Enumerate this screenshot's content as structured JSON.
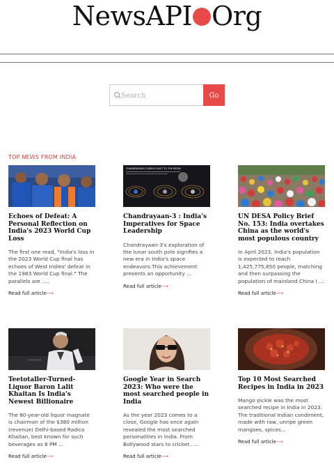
{
  "header": {
    "logo_left": "NewsAPI",
    "logo_right": "Org"
  },
  "search": {
    "placeholder": "Search",
    "button_label": "Go"
  },
  "section": {
    "title": "TOP NEWS FROM INDIA"
  },
  "articles": [
    {
      "title": "Echoes of Defeat: A Personal Reflection on India's 2023 World Cup Loss",
      "excerpt": "The first one read, \"India's loss in the 2023 World Cup final has echoes of West Indies' defeat in the 1983 World Cup final.\" The parallels are .....",
      "link": "Read full article⟶"
    },
    {
      "title": "Chandrayaan-3 : India's Imperatives for Space Leadership",
      "excerpt": "Chandrayaan-3's exploration of the lunar south pole signifies a new era in India's space endeavors.This achievement presents an opportunity ...",
      "link": "Read full article⟶",
      "image_caption": "CHANDRAYAAN-3 INDIA'S SHOT TO THE MOON"
    },
    {
      "title": "UN DESA Policy Brief No. 153: India overtakes China as the world's most populous country",
      "excerpt": "In April 2023, India's population is expected to reach 1,425,775,850 people, matching and then surpassing the population of mainland China ( ...",
      "link": "Read full article⟶"
    },
    {
      "title": "Teetotaller-Turned-Liquor Baron Lalit Khaitan Is India's Newest Billionaire",
      "excerpt": "The 80-year-old liquor magnate is chairman of the $380 million (revenue) Delhi-based Radico Khaitan, best known for such beverages as 8 PM ...",
      "link": "Read full article⟶"
    },
    {
      "title": "Google Year in Search 2023: Who were the most searched people in India",
      "excerpt": "As the year 2023 comes to a close, Google has once again revealed the most searched personalities in India. From Bollywood stars to cricket......",
      "link": "Read full article⟶"
    },
    {
      "title": "Top 10 Most Searched Recipes in India in 2023",
      "excerpt": "Mango pickle was the most searched recipe in India in 2023. The traditional Indian condiment, made with raw, unripe green mangoes, spices...",
      "link": "Read full article⟶"
    }
  ],
  "colors": {
    "accent": "#e84a4a",
    "section_title": "#d83b3b"
  }
}
